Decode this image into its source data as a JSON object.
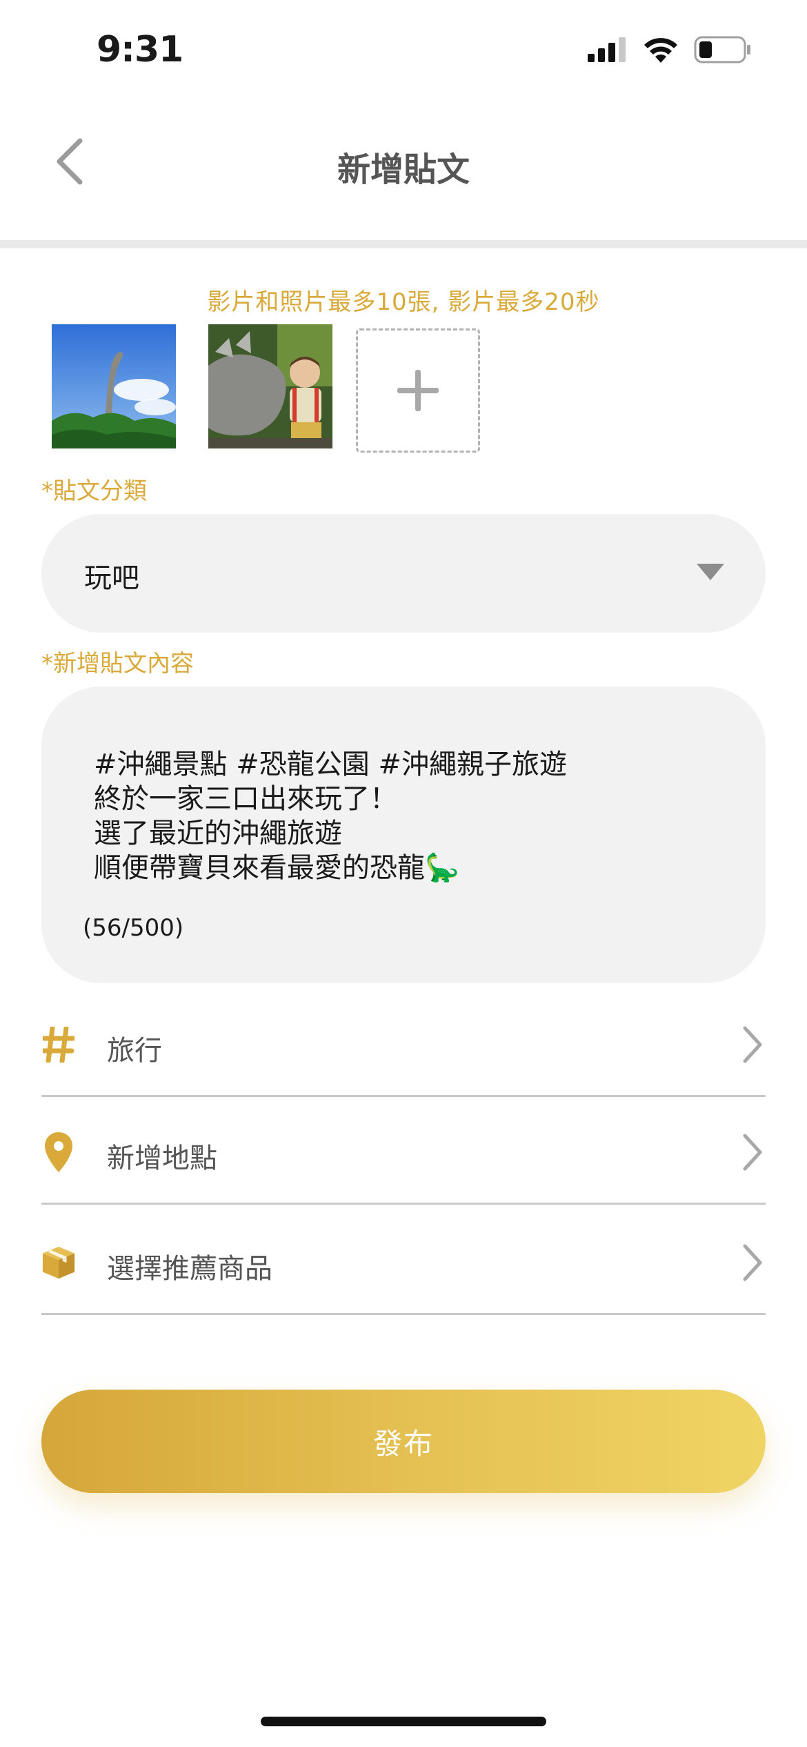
{
  "status_bar": {
    "time": "9:31"
  },
  "header": {
    "title": "新增貼文",
    "back_icon": "chevron-left-icon"
  },
  "media": {
    "hint": "影片和照片最多10張, 影片最多20秒",
    "thumbnails": [
      {
        "subject": "brachiosaurus statue against blue sky"
      },
      {
        "subject": "child with triceratops statue"
      }
    ],
    "add_icon": "plus-icon"
  },
  "category": {
    "label": "*貼文分類",
    "value": "玩吧",
    "caret_icon": "caret-down-icon"
  },
  "content": {
    "label": "*新增貼文內容",
    "lines": [
      "#沖繩景點 #恐龍公園 #沖繩親子旅遊",
      "終於一家三口出來玩了！",
      "選了最近的沖繩旅遊",
      "順便帶寶貝來看最愛的恐龍🦕"
    ],
    "char_count": "(56/500)"
  },
  "rows": {
    "tag": {
      "label": "旅行",
      "icon": "hashtag-icon"
    },
    "location": {
      "label": "新增地點",
      "icon": "location-pin-icon"
    },
    "product": {
      "label": "選擇推薦商品",
      "icon": "box-icon"
    }
  },
  "publish": {
    "label": "發布"
  },
  "colors": {
    "accent": "#d9a93a",
    "field_bg": "#f2f2f2",
    "button_start": "#d5a73a",
    "button_end": "#efd464"
  }
}
